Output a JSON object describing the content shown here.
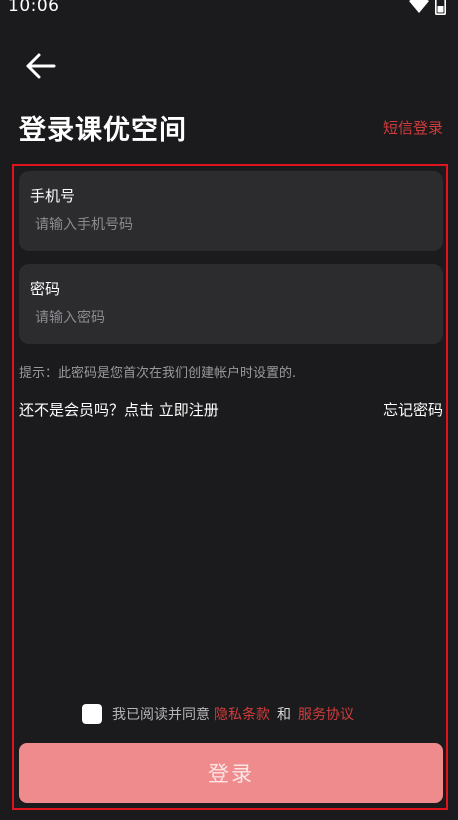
{
  "status_bar": {
    "time": "10:06"
  },
  "header": {
    "title": "登录课优空间",
    "sms_login_label": "短信登录"
  },
  "form": {
    "phone": {
      "label": "手机号",
      "placeholder": "请输入手机号码",
      "value": ""
    },
    "password": {
      "label": "密码",
      "placeholder": "请输入密码",
      "value": ""
    },
    "hint": "提示：此密码是您首次在我们创建帐户时设置的.",
    "register_text": "还不是会员吗？点击 立即注册",
    "forgot_password": "忘记密码"
  },
  "agreement": {
    "checked": false,
    "prefix": "我已阅读并同意",
    "privacy_link": "隐私条款",
    "and_text": "和",
    "service_link": "服务协议"
  },
  "login_button_label": "登录",
  "colors": {
    "background": "#1b1b1d",
    "card": "#2c2c2f",
    "accent_red": "#d23b3b",
    "button_pink": "#ef8b8d",
    "highlight_border": "#e0141e"
  },
  "icons": {
    "back": "arrow-left-icon",
    "wifi": "wifi-icon",
    "battery": "battery-icon"
  }
}
